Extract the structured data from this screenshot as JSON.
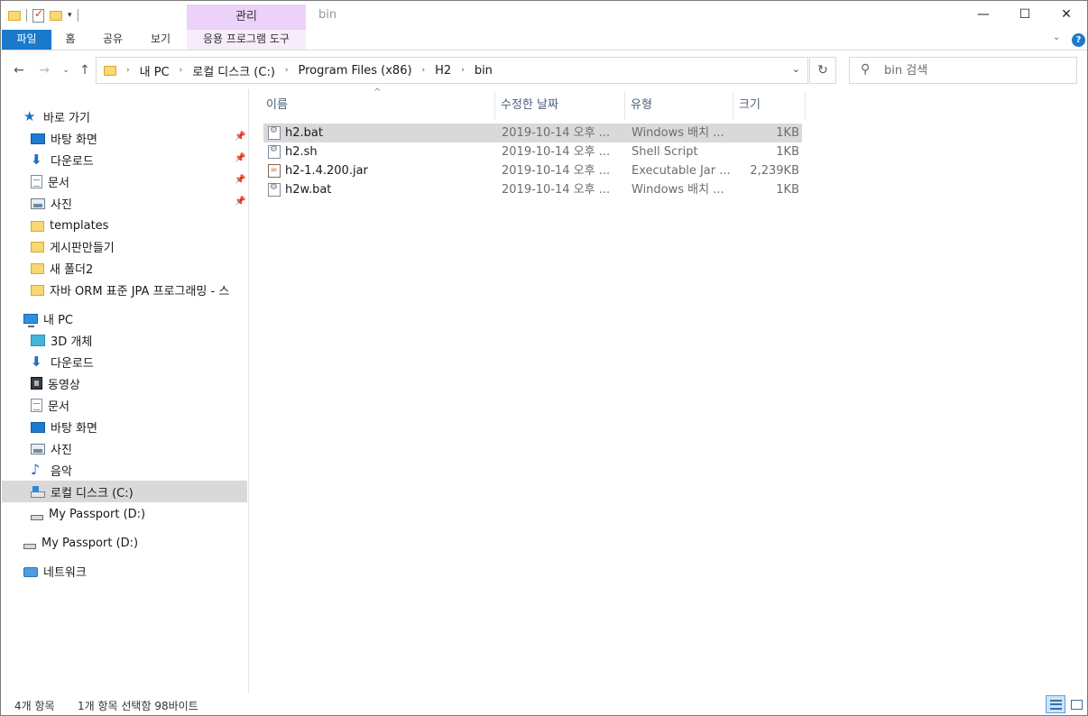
{
  "window": {
    "title": "bin",
    "context_tab_header": "관리",
    "minimize": "—",
    "maximize": "☐",
    "close": "✕"
  },
  "ribbon": {
    "file": "파일",
    "home": "홈",
    "share": "공유",
    "view": "보기",
    "context": "응용 프로그램 도구",
    "help": "?"
  },
  "address": {
    "crumbs": [
      "내 PC",
      "로컬 디스크 (C:)",
      "Program Files (x86)",
      "H2",
      "bin"
    ],
    "search_placeholder": "bin 검색"
  },
  "nav": {
    "quick_access": "바로 가기",
    "quick_items": [
      "바탕 화면",
      "다운로드",
      "문서",
      "사진",
      "templates",
      "게시판만들기",
      "새 폴더2",
      "자바 ORM 표준 JPA 프로그래밍 - 스"
    ],
    "this_pc": "내 PC",
    "pc_items": [
      "3D 개체",
      "다운로드",
      "동영상",
      "문서",
      "바탕 화면",
      "사진",
      "음악",
      "로컬 디스크 (C:)",
      "My Passport (D:)"
    ],
    "external": "My Passport (D:)",
    "network": "네트워크"
  },
  "columns": {
    "name": "이름",
    "date": "수정한 날짜",
    "type": "유형",
    "size": "크기"
  },
  "files": [
    {
      "name": "h2.bat",
      "date": "2019-10-14 오후 ...",
      "type": "Windows 배치 ...",
      "size": "1KB",
      "icon": "bat-file-icon"
    },
    {
      "name": "h2.sh",
      "date": "2019-10-14 오후 ...",
      "type": "Shell Script",
      "size": "1KB",
      "icon": "script-file-icon"
    },
    {
      "name": "h2-1.4.200.jar",
      "date": "2019-10-14 오후 ...",
      "type": "Executable Jar ...",
      "size": "2,239KB",
      "icon": "jar-file-icon"
    },
    {
      "name": "h2w.bat",
      "date": "2019-10-14 오후 ...",
      "type": "Windows 배치 ...",
      "size": "1KB",
      "icon": "bat-file-icon"
    }
  ],
  "selected_file_index": 0,
  "status": {
    "count": "4개 항목",
    "selection": "1개 항목 선택함 98바이트"
  },
  "colors": {
    "accent": "#1979ca",
    "context_tab": "#ecd1f8",
    "selection": "#d9d9d9"
  }
}
